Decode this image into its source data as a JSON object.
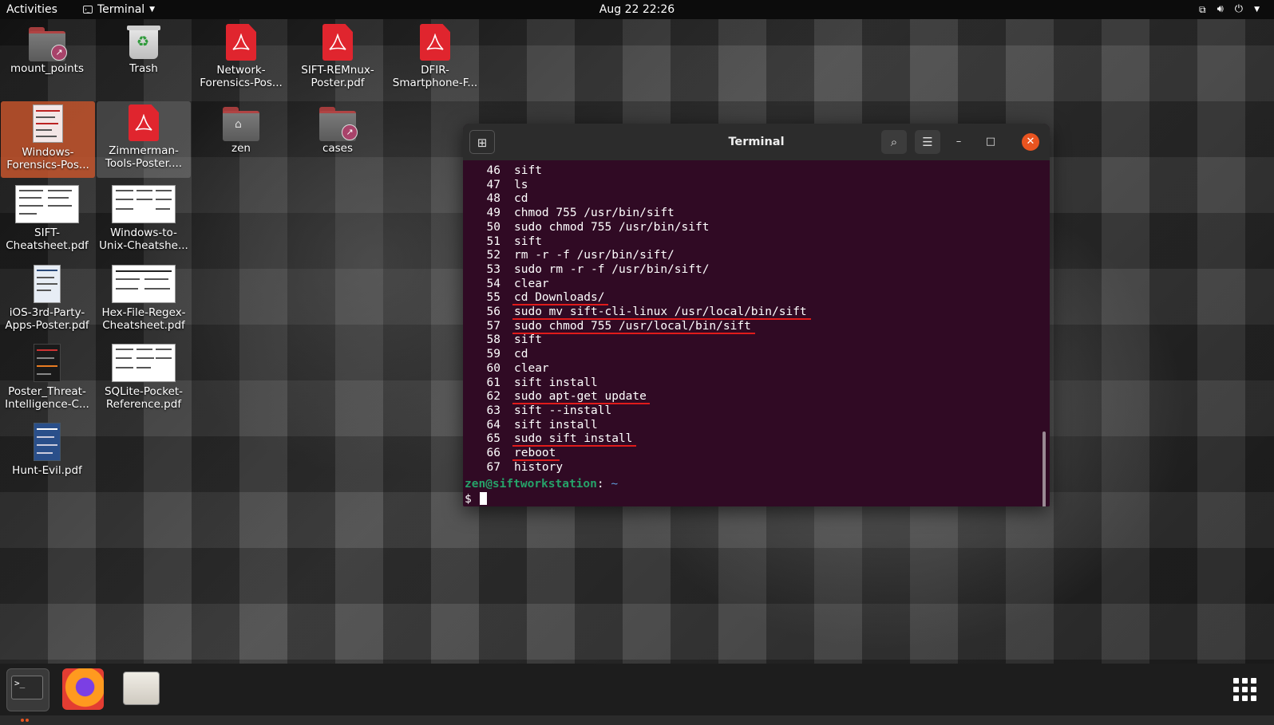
{
  "topbar": {
    "activities": "Activities",
    "app_name": "Terminal",
    "clock": "Aug 22  22:26"
  },
  "desktop_icons": {
    "mount_points": "mount_points",
    "trash": "Trash",
    "network_forensics": "Network-\nForensics-Pos...",
    "sift_remnux": "SIFT-REMnux-\nPoster.pdf",
    "dfir_smartphone": "DFIR-\nSmartphone-F...",
    "windows_forensics": "Windows-\nForensics-Pos...",
    "zimmerman": "Zimmerman-\nTools-Poster....",
    "zen": "zen",
    "cases": "cases",
    "sift_cheatsheet": "SIFT-\nCheatsheet.pdf",
    "windows_to_unix": "Windows-to-\nUnix-Cheatshe...",
    "ios_3rd_party": "iOS-3rd-Party-\nApps-Poster.pdf",
    "hex_file_regex": "Hex-File-Regex-\nCheatsheet.pdf",
    "poster_threat": "Poster_Threat-\nIntelligence-C...",
    "sqlite_pocket": "SQLite-Pocket-\nReference.pdf",
    "hunt_evil": "Hunt-Evil.pdf"
  },
  "terminal": {
    "title": "Terminal",
    "history": [
      {
        "n": "46",
        "cmd": "sift"
      },
      {
        "n": "47",
        "cmd": "ls"
      },
      {
        "n": "48",
        "cmd": "cd"
      },
      {
        "n": "49",
        "cmd": "chmod 755 /usr/bin/sift"
      },
      {
        "n": "50",
        "cmd": "sudo chmod 755 /usr/bin/sift"
      },
      {
        "n": "51",
        "cmd": "sift"
      },
      {
        "n": "52",
        "cmd": "rm -r -f /usr/bin/sift/"
      },
      {
        "n": "53",
        "cmd": "sudo rm -r -f /usr/bin/sift/"
      },
      {
        "n": "54",
        "cmd": "clear"
      },
      {
        "n": "55",
        "cmd": "cd Downloads/"
      },
      {
        "n": "56",
        "cmd": "sudo mv sift-cli-linux /usr/local/bin/sift"
      },
      {
        "n": "57",
        "cmd": "sudo chmod 755 /usr/local/bin/sift"
      },
      {
        "n": "58",
        "cmd": "sift"
      },
      {
        "n": "59",
        "cmd": "cd"
      },
      {
        "n": "60",
        "cmd": "clear"
      },
      {
        "n": "61",
        "cmd": "sift install"
      },
      {
        "n": "62",
        "cmd": "sudo apt-get update"
      },
      {
        "n": "63",
        "cmd": "sift --install"
      },
      {
        "n": "64",
        "cmd": "sift install"
      },
      {
        "n": "65",
        "cmd": "sudo sift install"
      },
      {
        "n": "66",
        "cmd": "reboot"
      },
      {
        "n": "67",
        "cmd": "history"
      }
    ],
    "underlined": [
      "55",
      "56",
      "57",
      "62",
      "65",
      "66"
    ],
    "prompt_user": "zen@siftworkstation",
    "prompt_sep": ":",
    "prompt_dir": " ~",
    "prompt_symbol": "$"
  },
  "colors": {
    "terminal_bg": "#300a24",
    "prompt_green": "#26a269",
    "underline_red": "#e01b1b",
    "accent_orange": "#e95420"
  }
}
